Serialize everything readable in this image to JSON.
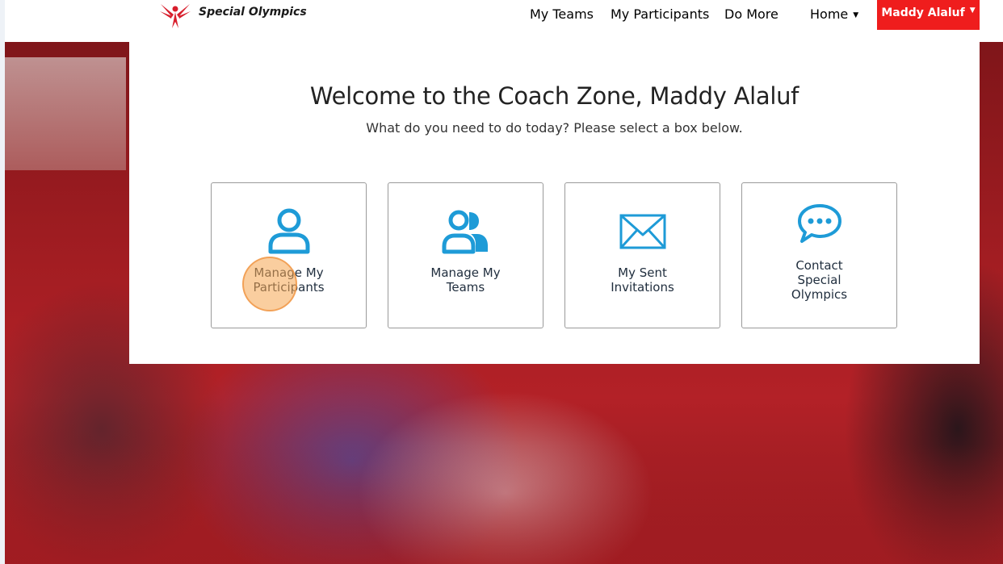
{
  "brand": {
    "name": "Special Olympics",
    "accent_color": "#ef1d1d",
    "icon_color": "#1e9bd7"
  },
  "nav": {
    "items": [
      {
        "label": "My Teams"
      },
      {
        "label": "My Participants"
      },
      {
        "label": "Do More"
      },
      {
        "label": "Home"
      }
    ],
    "user_label": "Maddy Alaluf"
  },
  "main": {
    "title": "Welcome to the Coach Zone, Maddy Alaluf",
    "subtitle": "What do you need to do today? Please select a box below.",
    "cards": [
      {
        "line1": "Manage My",
        "line2": "Participants",
        "line3": "",
        "icon": "user-icon"
      },
      {
        "line1": "Manage My",
        "line2": "Teams",
        "line3": "",
        "icon": "team-icon"
      },
      {
        "line1": "My Sent",
        "line2": "Invitations",
        "line3": "",
        "icon": "envelope-icon"
      },
      {
        "line1": "Contact",
        "line2": "Special",
        "line3": "Olympics",
        "icon": "chat-bubble-icon"
      }
    ]
  }
}
